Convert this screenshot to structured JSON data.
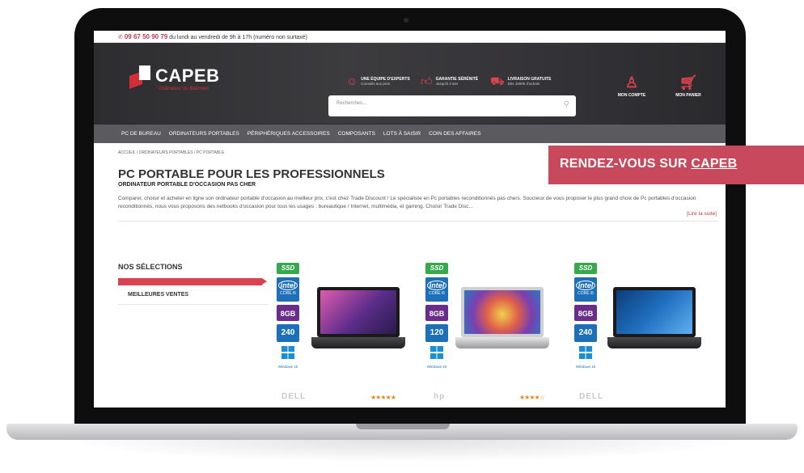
{
  "topbar": {
    "phone": "09 67 50 90 79",
    "hours": "du lundi au vendredi de 9h à 17h (numéro non surtaxé)"
  },
  "header": {
    "logo_text": "CAPEB",
    "logo_sub": "Ordinateur du Bâtiment",
    "usps": [
      {
        "title": "UNE ÉQUIPE D'EXPERTS",
        "sub": "Conseils aux pros",
        "icon": "user-headset-icon"
      },
      {
        "title": "GARANTIE SÉRÉNITÉ",
        "sub": "Jusqu'à 3 ans",
        "icon": "thumbs-up-icon"
      },
      {
        "title": "LIVRAISON GRATUITE",
        "sub": "Dès 1000€ d'achats",
        "icon": "truck-icon"
      }
    ],
    "search_placeholder": "Recherches...",
    "account_label": "MON COMPTE",
    "cart_label": "MON PANIER"
  },
  "nav": [
    "PC DE BUREAU",
    "ORDINATEURS PORTABLES",
    "PÉRIPHÉRIQUES ACCESSOIRES",
    "COMPOSANTS",
    "LOTS À SAISIR",
    "COIN DES AFFAIRES"
  ],
  "breadcrumb": "ACCUEIL / ORDINATEURS PORTABLES / PC PORTABLE",
  "page": {
    "title": "PC PORTABLE POUR LES PROFESSIONNELS",
    "subtitle": "ORDINATEUR PORTABLE D'OCCASION PAS CHER",
    "description": "Comparer, choisir et acheter en ligne son ordinateur portable d'occasion au meilleur prix, c'est chez Trade Discount ! Le spécialiste en Pc portables reconditionnés pas chers. Soucieux de vous proposer le plus grand choix de Pc portables d'occasion reconditionnés, nous vous proposons des netbooks d'occasion pour tous les usages : bureautique / Internet, multimédia, et gaming. Choisir Trade Disc...",
    "read_more": "[Lire la suite]"
  },
  "sidebar": {
    "title": "NOS SÉLECTIONS",
    "items": [
      "MEILLEURES VENTES"
    ]
  },
  "products": [
    {
      "ssd": "SSD",
      "cpu": "CORE i5",
      "ram": "8GB",
      "disk": "240",
      "os": "Windows 10",
      "brand": "DELL",
      "stars": "★★★★★",
      "rating": 5,
      "display_color": "#8a3fa0"
    },
    {
      "ssd": "SSD",
      "cpu": "CORE i5",
      "ram": "8GB",
      "disk": "120",
      "os": "Windows 10",
      "brand": "hp",
      "stars": "★★★★☆",
      "rating": 4,
      "display_color": "#c05a3c"
    },
    {
      "ssd": "SSD",
      "cpu": "CORE i5",
      "ram": "8GB",
      "disk": "240",
      "os": "Windows 10",
      "brand": "DELL",
      "stars": "",
      "rating": null,
      "display_color": "#1f6fc0"
    }
  ],
  "promo": {
    "text": "RENDEZ-VOUS SUR ",
    "link": "CAPEB"
  },
  "colors": {
    "accent": "#d9434f",
    "header_bg": "#333235",
    "nav_bg": "#5b5a5e",
    "promo_bg": "#c8495b"
  }
}
